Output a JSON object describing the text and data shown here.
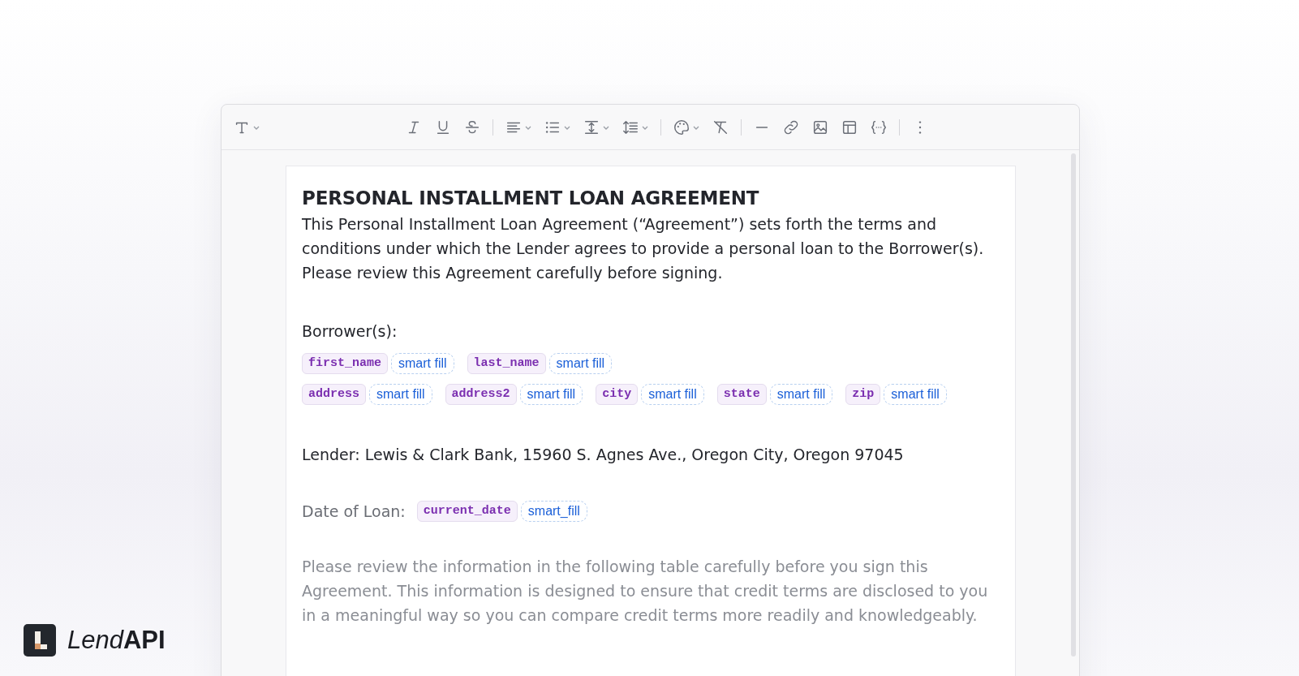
{
  "document": {
    "title": "PERSONAL INSTALLMENT LOAN AGREEMENT",
    "intro": "This Personal Installment Loan Agreement (“Agreement”) sets forth the terms and conditions under which the Lender agrees to provide a personal loan to the Borrower(s). Please review this Agreement carefully before signing.",
    "borrowers_label": "Borrower(s):",
    "field_rows": [
      [
        {
          "variable": "first_name",
          "action": "smart fill"
        },
        {
          "variable": "last_name",
          "action": "smart fill"
        }
      ],
      [
        {
          "variable": "address",
          "action": "smart fill"
        },
        {
          "variable": "address2",
          "action": "smart fill"
        },
        {
          "variable": "city",
          "action": "smart fill"
        },
        {
          "variable": "state",
          "action": "smart fill"
        },
        {
          "variable": "zip",
          "action": "smart fill"
        }
      ]
    ],
    "lender": "Lender: Lewis & Clark Bank, 15960 S. Agnes Ave., Oregon City, Oregon 97045",
    "date_label": "Date of Loan:",
    "date_field": {
      "variable": "current_date",
      "action": "smart_fill"
    },
    "disclosure": "Please review the information in the following table carefully before you sign this Agreement. This information is designed to ensure that credit terms are disclosed to you in a meaningful way so you can compare credit terms more readily and knowledgeably."
  },
  "logo": {
    "light": "Lend",
    "bold": "API"
  }
}
